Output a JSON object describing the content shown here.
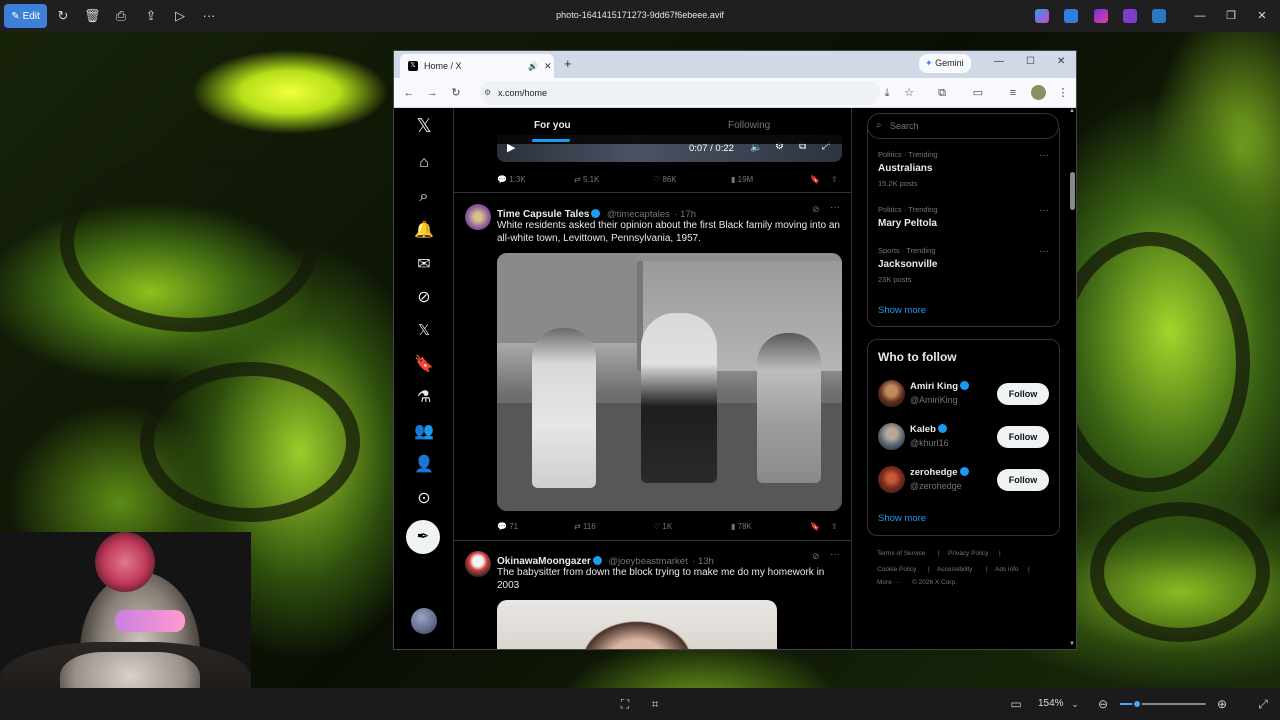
{
  "viewer": {
    "filename": "photo-1641415171273-9dd67f6ebeee.avif",
    "edit_label": "Edit",
    "zoom": "154%",
    "zoom_fraction": 0.2
  },
  "browser": {
    "tab_title": "Home / X",
    "url": "x.com/home",
    "gemini_label": "Gemini"
  },
  "feed": {
    "tabs": [
      "For you",
      "Following"
    ],
    "video": {
      "time": "0:07 / 0:22"
    },
    "top_metrics": {
      "replies": "1.3K",
      "reposts": "5.1K",
      "likes": "86K",
      "views": "19M"
    },
    "tweets": [
      {
        "name": "Time Capsule Tales",
        "handle": "@timecaptales",
        "time": "· 17h",
        "text": "White residents asked their opinion about the first Black family moving into an all-white town, Levittown, Pennsylvania, 1957.",
        "metrics": {
          "replies": "71",
          "reposts": "116",
          "likes": "1K",
          "views": "78K"
        }
      },
      {
        "name": "OkinawaMoongazer",
        "handle": "@joeybeastmarket",
        "time": "· 13h",
        "text": "The babysitter from down the block trying to make me do my homework in 2003"
      }
    ]
  },
  "sidebar": {
    "search_placeholder": "Search",
    "trends": [
      {
        "category": "Politics · Trending",
        "name": "Australians",
        "count": "15.2K posts"
      },
      {
        "category": "Politics · Trending",
        "name": "Mary Peltola",
        "count": ""
      },
      {
        "category": "Sports · Trending",
        "name": "Jacksonville",
        "count": "23K posts"
      }
    ],
    "show_more": "Show more",
    "who_to_follow": {
      "title": "Who to follow",
      "users": [
        {
          "name": "Amiri King",
          "handle": "@AmiriKing",
          "button": "Follow"
        },
        {
          "name": "Kaleb",
          "handle": "@khurl16",
          "button": "Follow"
        },
        {
          "name": "zerohedge",
          "handle": "@zerohedge",
          "button": "Follow"
        }
      ],
      "show_more": "Show more"
    },
    "footer": {
      "terms": "Terms of Service",
      "privacy": "Privacy Policy",
      "cookie": "Cookie Policy",
      "accessibility": "Accessibility",
      "ads": "Ads info",
      "more": "More ···",
      "copyright": "© 2026 X Corp."
    }
  },
  "colors": {
    "accent": "#1d9bf0",
    "edit": "#3d80d8",
    "background": "#000000"
  }
}
